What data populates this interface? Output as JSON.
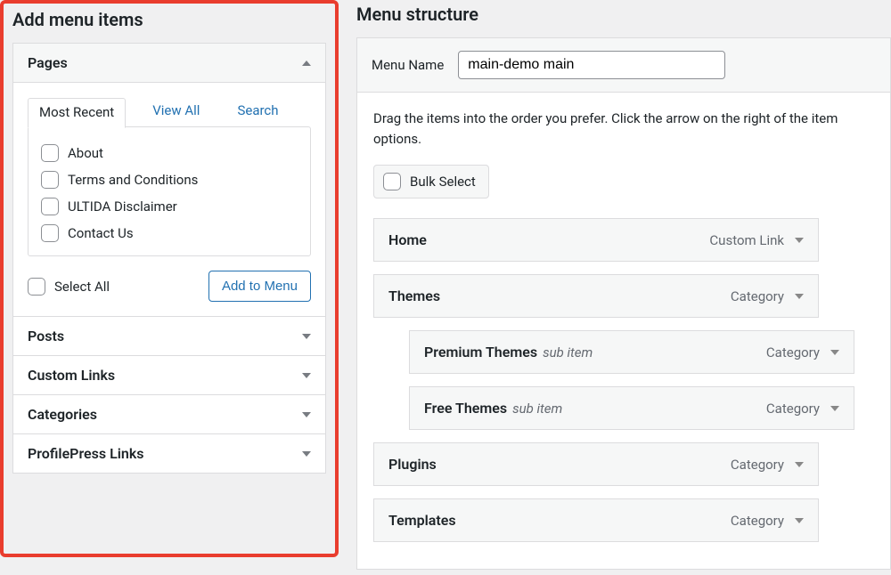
{
  "left": {
    "heading": "Add menu items",
    "panels": {
      "pages": {
        "title": "Pages",
        "tabs": {
          "most_recent": "Most Recent",
          "view_all": "View All",
          "search": "Search"
        },
        "items": [
          {
            "label": "About"
          },
          {
            "label": "Terms and Conditions"
          },
          {
            "label": "ULTIDA Disclaimer"
          },
          {
            "label": "Contact Us"
          }
        ],
        "select_all": "Select All",
        "add_button": "Add to Menu"
      },
      "posts": "Posts",
      "custom_links": "Custom Links",
      "categories": "Categories",
      "profilepress": "ProfilePress Links"
    }
  },
  "right": {
    "heading": "Menu structure",
    "menu_name_label": "Menu Name",
    "menu_name_value": "main-demo main",
    "instructions": "Drag the items into the order you prefer. Click the arrow on the right of the item options.",
    "bulk_select": "Bulk Select",
    "type_labels": {
      "custom_link": "Custom Link",
      "category": "Category"
    },
    "sub_item_label": "sub item",
    "items": [
      {
        "title": "Home",
        "type": "custom_link",
        "depth": 0
      },
      {
        "title": "Themes",
        "type": "category",
        "depth": 0
      },
      {
        "title": "Premium Themes",
        "type": "category",
        "depth": 1
      },
      {
        "title": "Free Themes",
        "type": "category",
        "depth": 1
      },
      {
        "title": "Plugins",
        "type": "category",
        "depth": 0
      },
      {
        "title": "Templates",
        "type": "category",
        "depth": 0
      }
    ]
  }
}
